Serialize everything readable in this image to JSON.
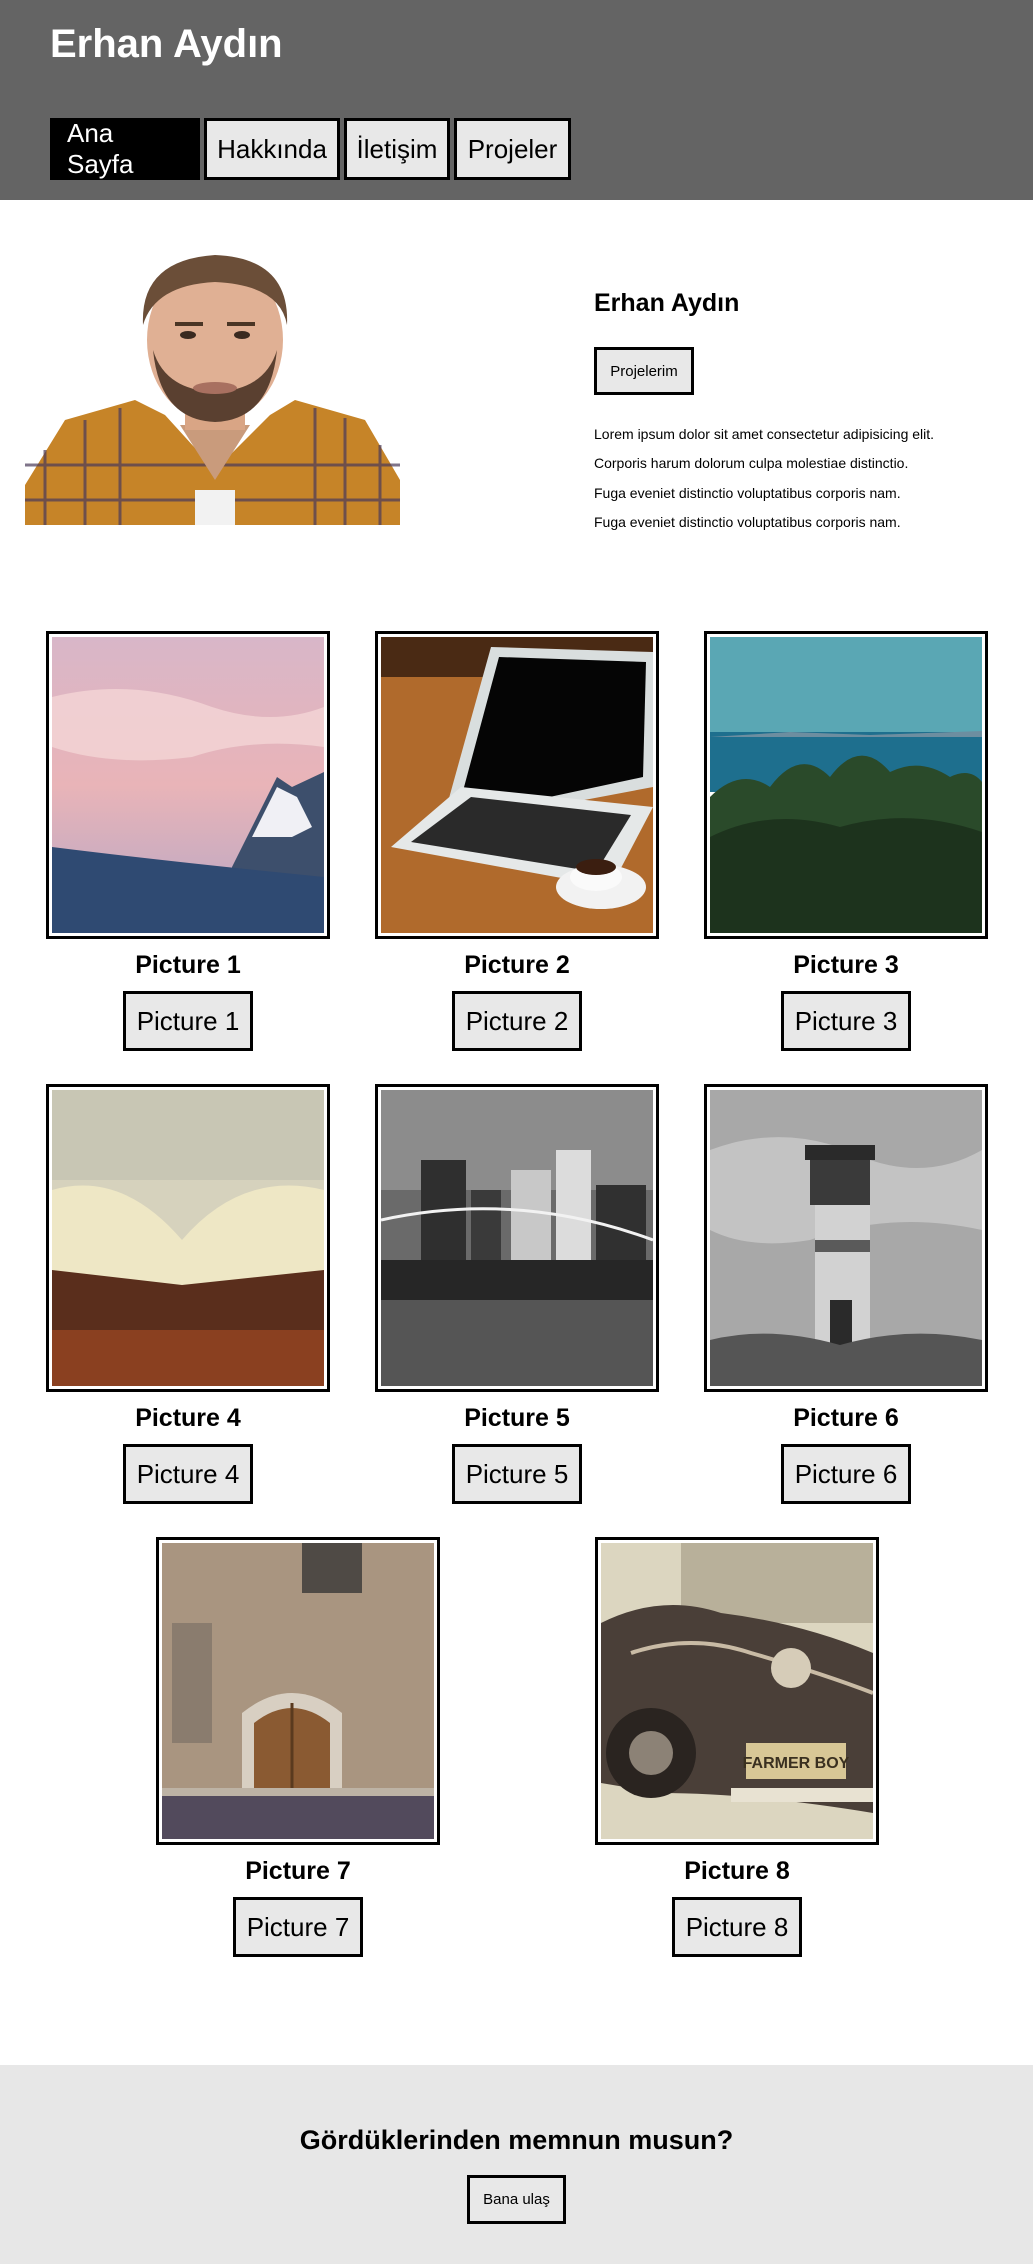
{
  "header": {
    "site_title": "Erhan Aydın",
    "nav": [
      {
        "label": "Ana Sayfa",
        "active": true
      },
      {
        "label": "Hakkında",
        "active": false
      },
      {
        "label": "İletişim",
        "active": false
      },
      {
        "label": "Projeler",
        "active": false
      }
    ]
  },
  "profile": {
    "name": "Erhan Aydın",
    "button_label": "Projelerim",
    "bio": [
      "Lorem ipsum dolor sit amet consectetur adipisicing elit.",
      "Corporis harum dolorum culpa molestiae distinctio.",
      "Fuga eveniet distinctio voluptatibus corporis nam.",
      "Fuga eveniet distinctio voluptatibus corporis nam."
    ]
  },
  "gallery": [
    {
      "title": "Picture 1",
      "button": "Picture 1",
      "image": "snowy-mountain-pink-sky"
    },
    {
      "title": "Picture 2",
      "button": "Picture 2",
      "image": "laptop-and-coffee"
    },
    {
      "title": "Picture 3",
      "button": "Picture 3",
      "image": "forest-and-sea"
    },
    {
      "title": "Picture 4",
      "button": "Picture 4",
      "image": "open-book"
    },
    {
      "title": "Picture 5",
      "button": "Picture 5",
      "image": "city-bridge-night"
    },
    {
      "title": "Picture 6",
      "button": "Picture 6",
      "image": "lighthouse"
    },
    {
      "title": "Picture 7",
      "button": "Picture 7",
      "image": "old-building-door"
    },
    {
      "title": "Picture 8",
      "button": "Picture 8",
      "image": "vintage-car"
    }
  ],
  "footer": {
    "title": "Gördüklerinden memnun musun?",
    "button_label": "Bana ulaş"
  },
  "colors": {
    "header_bg": "#646464",
    "nav_active_bg": "#000000",
    "button_bg": "#e8e8e8",
    "footer_bg": "#e7e7e7"
  }
}
